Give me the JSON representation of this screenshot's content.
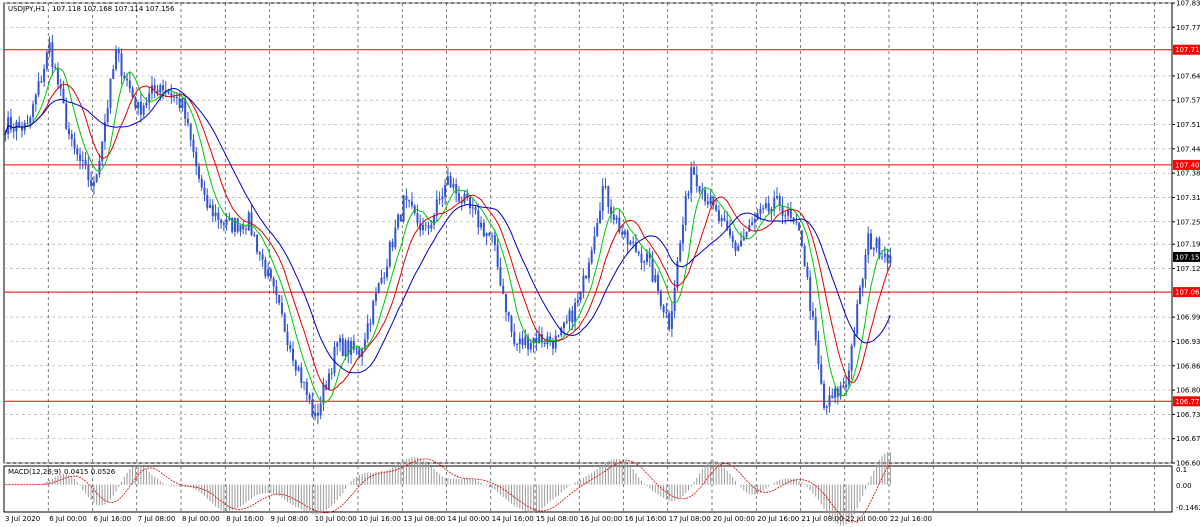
{
  "header": {
    "symbol": "USDJPY,H1",
    "ohlc": "107.118 107.168 107.114 107.156"
  },
  "macd": {
    "label": "MACD(12,26,9)",
    "values": "0.0415 0.0526",
    "axis_labels": [
      "0.1",
      "0.00",
      "-0.1462"
    ]
  },
  "colors": {
    "candles": "#3355cc",
    "ma_fast": "#00c800",
    "ma_mid": "#e00000",
    "ma_slow": "#0000c8",
    "levels": "#ff0000",
    "current_tag": "#000000",
    "grid": "#b0b0b0"
  },
  "chart_data": [
    {
      "type": "candlestick",
      "symbol": "USDJPY",
      "timeframe": "H1",
      "grid": true,
      "price_axis_labels": [
        "107.835",
        "107.770",
        "107.710",
        "107.640",
        "107.575",
        "107.510",
        "107.445",
        "107.380",
        "107.315",
        "107.250",
        "107.190",
        "107.125",
        "107.062",
        "106.995",
        "106.930",
        "106.865",
        "106.800",
        "106.735",
        "106.670",
        "106.605"
      ],
      "y_range": [
        106.605,
        107.835
      ],
      "time_labels": [
        "3 Jul 2020",
        "6 Jul 00:00",
        "6 Jul 16:00",
        "7 Jul 08:00",
        "8 Jul 00:00",
        "8 Jul 16:00",
        "9 Jul 08:00",
        "10 Jul 00:00",
        "10 Jul 16:00",
        "13 Jul 08:00",
        "14 Jul 00:00",
        "14 Jul 16:00",
        "15 Jul 08:00",
        "16 Jul 00:00",
        "16 Jul 16:00",
        "17 Jul 08:00",
        "20 Jul 00:00",
        "20 Jul 16:00",
        "21 Jul 08:00",
        "22 Jul 00:00",
        "22 Jul 16:00"
      ],
      "horizontal_levels": [
        "107.710",
        "107.402",
        "107.062",
        "106.770"
      ],
      "current_price": "107.156",
      "approx_close_path": [
        [
          "3 Jul 2020",
          107.51
        ],
        [
          "6 Jul 00:00",
          107.5
        ],
        [
          "6 Jul 08:00",
          107.72
        ],
        [
          "6 Jul 16:00",
          107.45
        ],
        [
          "7 Jul 00:00",
          107.34
        ],
        [
          "7 Jul 08:00",
          107.7
        ],
        [
          "7 Jul 16:00",
          107.55
        ],
        [
          "8 Jul 00:00",
          107.62
        ],
        [
          "8 Jul 08:00",
          107.56
        ],
        [
          "8 Jul 16:00",
          107.3
        ],
        [
          "9 Jul 00:00",
          107.24
        ],
        [
          "9 Jul 08:00",
          107.25
        ],
        [
          "9 Jul 16:00",
          107.08
        ],
        [
          "10 Jul 00:00",
          106.9
        ],
        [
          "10 Jul 08:00",
          106.72
        ],
        [
          "10 Jul 16:00",
          106.92
        ],
        [
          "13 Jul 00:00",
          106.9
        ],
        [
          "13 Jul 08:00",
          107.1
        ],
        [
          "13 Jul 16:00",
          107.3
        ],
        [
          "14 Jul 00:00",
          107.22
        ],
        [
          "14 Jul 08:00",
          107.36
        ],
        [
          "14 Jul 16:00",
          107.28
        ],
        [
          "15 Jul 00:00",
          107.2
        ],
        [
          "15 Jul 08:00",
          106.92
        ],
        [
          "15 Jul 16:00",
          106.94
        ],
        [
          "16 Jul 00:00",
          106.93
        ],
        [
          "16 Jul 08:00",
          107.05
        ],
        [
          "16 Jul 16:00",
          107.34
        ],
        [
          "17 Jul 00:00",
          107.2
        ],
        [
          "17 Jul 08:00",
          107.15
        ],
        [
          "17 Jul 16:00",
          106.98
        ],
        [
          "20 Jul 00:00",
          107.4
        ],
        [
          "20 Jul 08:00",
          107.28
        ],
        [
          "20 Jul 16:00",
          107.18
        ],
        [
          "21 Jul 00:00",
          107.26
        ],
        [
          "21 Jul 08:00",
          107.3
        ],
        [
          "21 Jul 16:00",
          107.2
        ],
        [
          "22 Jul 00:00",
          106.75
        ],
        [
          "22 Jul 08:00",
          106.82
        ],
        [
          "22 Jul 16:00",
          107.2
        ],
        [
          "23 Jul 00:00",
          107.16
        ]
      ]
    },
    {
      "type": "histogram",
      "name": "MACD(12,26,9)",
      "y_range": [
        -0.1462,
        0.1
      ],
      "axis_labels": [
        "0.1",
        "0.00",
        "-0.1462"
      ],
      "main_value": 0.0415,
      "signal_value": 0.0526
    }
  ]
}
